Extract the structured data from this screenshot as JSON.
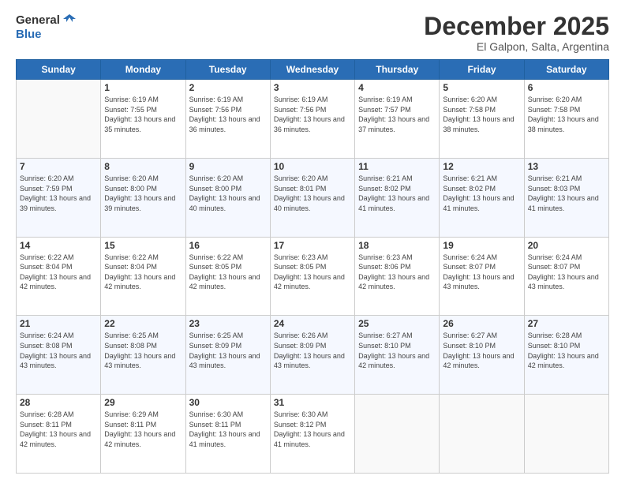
{
  "header": {
    "logo_line1": "General",
    "logo_line2": "Blue",
    "month": "December 2025",
    "location": "El Galpon, Salta, Argentina"
  },
  "days_of_week": [
    "Sunday",
    "Monday",
    "Tuesday",
    "Wednesday",
    "Thursday",
    "Friday",
    "Saturday"
  ],
  "weeks": [
    [
      {
        "day": "",
        "sunrise": "",
        "sunset": "",
        "daylight": ""
      },
      {
        "day": "1",
        "sunrise": "Sunrise: 6:19 AM",
        "sunset": "Sunset: 7:55 PM",
        "daylight": "Daylight: 13 hours and 35 minutes."
      },
      {
        "day": "2",
        "sunrise": "Sunrise: 6:19 AM",
        "sunset": "Sunset: 7:56 PM",
        "daylight": "Daylight: 13 hours and 36 minutes."
      },
      {
        "day": "3",
        "sunrise": "Sunrise: 6:19 AM",
        "sunset": "Sunset: 7:56 PM",
        "daylight": "Daylight: 13 hours and 36 minutes."
      },
      {
        "day": "4",
        "sunrise": "Sunrise: 6:19 AM",
        "sunset": "Sunset: 7:57 PM",
        "daylight": "Daylight: 13 hours and 37 minutes."
      },
      {
        "day": "5",
        "sunrise": "Sunrise: 6:20 AM",
        "sunset": "Sunset: 7:58 PM",
        "daylight": "Daylight: 13 hours and 38 minutes."
      },
      {
        "day": "6",
        "sunrise": "Sunrise: 6:20 AM",
        "sunset": "Sunset: 7:58 PM",
        "daylight": "Daylight: 13 hours and 38 minutes."
      }
    ],
    [
      {
        "day": "7",
        "sunrise": "Sunrise: 6:20 AM",
        "sunset": "Sunset: 7:59 PM",
        "daylight": "Daylight: 13 hours and 39 minutes."
      },
      {
        "day": "8",
        "sunrise": "Sunrise: 6:20 AM",
        "sunset": "Sunset: 8:00 PM",
        "daylight": "Daylight: 13 hours and 39 minutes."
      },
      {
        "day": "9",
        "sunrise": "Sunrise: 6:20 AM",
        "sunset": "Sunset: 8:00 PM",
        "daylight": "Daylight: 13 hours and 40 minutes."
      },
      {
        "day": "10",
        "sunrise": "Sunrise: 6:20 AM",
        "sunset": "Sunset: 8:01 PM",
        "daylight": "Daylight: 13 hours and 40 minutes."
      },
      {
        "day": "11",
        "sunrise": "Sunrise: 6:21 AM",
        "sunset": "Sunset: 8:02 PM",
        "daylight": "Daylight: 13 hours and 41 minutes."
      },
      {
        "day": "12",
        "sunrise": "Sunrise: 6:21 AM",
        "sunset": "Sunset: 8:02 PM",
        "daylight": "Daylight: 13 hours and 41 minutes."
      },
      {
        "day": "13",
        "sunrise": "Sunrise: 6:21 AM",
        "sunset": "Sunset: 8:03 PM",
        "daylight": "Daylight: 13 hours and 41 minutes."
      }
    ],
    [
      {
        "day": "14",
        "sunrise": "Sunrise: 6:22 AM",
        "sunset": "Sunset: 8:04 PM",
        "daylight": "Daylight: 13 hours and 42 minutes."
      },
      {
        "day": "15",
        "sunrise": "Sunrise: 6:22 AM",
        "sunset": "Sunset: 8:04 PM",
        "daylight": "Daylight: 13 hours and 42 minutes."
      },
      {
        "day": "16",
        "sunrise": "Sunrise: 6:22 AM",
        "sunset": "Sunset: 8:05 PM",
        "daylight": "Daylight: 13 hours and 42 minutes."
      },
      {
        "day": "17",
        "sunrise": "Sunrise: 6:23 AM",
        "sunset": "Sunset: 8:05 PM",
        "daylight": "Daylight: 13 hours and 42 minutes."
      },
      {
        "day": "18",
        "sunrise": "Sunrise: 6:23 AM",
        "sunset": "Sunset: 8:06 PM",
        "daylight": "Daylight: 13 hours and 42 minutes."
      },
      {
        "day": "19",
        "sunrise": "Sunrise: 6:24 AM",
        "sunset": "Sunset: 8:07 PM",
        "daylight": "Daylight: 13 hours and 43 minutes."
      },
      {
        "day": "20",
        "sunrise": "Sunrise: 6:24 AM",
        "sunset": "Sunset: 8:07 PM",
        "daylight": "Daylight: 13 hours and 43 minutes."
      }
    ],
    [
      {
        "day": "21",
        "sunrise": "Sunrise: 6:24 AM",
        "sunset": "Sunset: 8:08 PM",
        "daylight": "Daylight: 13 hours and 43 minutes."
      },
      {
        "day": "22",
        "sunrise": "Sunrise: 6:25 AM",
        "sunset": "Sunset: 8:08 PM",
        "daylight": "Daylight: 13 hours and 43 minutes."
      },
      {
        "day": "23",
        "sunrise": "Sunrise: 6:25 AM",
        "sunset": "Sunset: 8:09 PM",
        "daylight": "Daylight: 13 hours and 43 minutes."
      },
      {
        "day": "24",
        "sunrise": "Sunrise: 6:26 AM",
        "sunset": "Sunset: 8:09 PM",
        "daylight": "Daylight: 13 hours and 43 minutes."
      },
      {
        "day": "25",
        "sunrise": "Sunrise: 6:27 AM",
        "sunset": "Sunset: 8:10 PM",
        "daylight": "Daylight: 13 hours and 42 minutes."
      },
      {
        "day": "26",
        "sunrise": "Sunrise: 6:27 AM",
        "sunset": "Sunset: 8:10 PM",
        "daylight": "Daylight: 13 hours and 42 minutes."
      },
      {
        "day": "27",
        "sunrise": "Sunrise: 6:28 AM",
        "sunset": "Sunset: 8:10 PM",
        "daylight": "Daylight: 13 hours and 42 minutes."
      }
    ],
    [
      {
        "day": "28",
        "sunrise": "Sunrise: 6:28 AM",
        "sunset": "Sunset: 8:11 PM",
        "daylight": "Daylight: 13 hours and 42 minutes."
      },
      {
        "day": "29",
        "sunrise": "Sunrise: 6:29 AM",
        "sunset": "Sunset: 8:11 PM",
        "daylight": "Daylight: 13 hours and 42 minutes."
      },
      {
        "day": "30",
        "sunrise": "Sunrise: 6:30 AM",
        "sunset": "Sunset: 8:11 PM",
        "daylight": "Daylight: 13 hours and 41 minutes."
      },
      {
        "day": "31",
        "sunrise": "Sunrise: 6:30 AM",
        "sunset": "Sunset: 8:12 PM",
        "daylight": "Daylight: 13 hours and 41 minutes."
      },
      {
        "day": "",
        "sunrise": "",
        "sunset": "",
        "daylight": ""
      },
      {
        "day": "",
        "sunrise": "",
        "sunset": "",
        "daylight": ""
      },
      {
        "day": "",
        "sunrise": "",
        "sunset": "",
        "daylight": ""
      }
    ]
  ]
}
